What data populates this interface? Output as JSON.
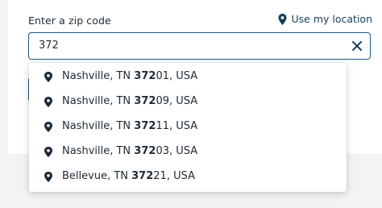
{
  "zip": {
    "label": "Enter a zip code",
    "value": "372",
    "use_location_label": "Use my location"
  },
  "suggestions": [
    {
      "prefix": "Nashville, TN ",
      "match": "372",
      "rest": "01, USA"
    },
    {
      "prefix": "Nashville, TN ",
      "match": "372",
      "rest": "09, USA"
    },
    {
      "prefix": "Nashville, TN ",
      "match": "372",
      "rest": "11, USA"
    },
    {
      "prefix": "Nashville, TN ",
      "match": "372",
      "rest": "03, USA"
    },
    {
      "prefix": "Bellevue, TN ",
      "match": "372",
      "rest": "21, USA"
    }
  ],
  "colors": {
    "accent": "#1f5b80",
    "link": "#143d59",
    "icon": "#1b2a3a",
    "text": "#1f2a33"
  },
  "icons": {
    "location": "map-pin-icon",
    "clear": "close-icon"
  }
}
